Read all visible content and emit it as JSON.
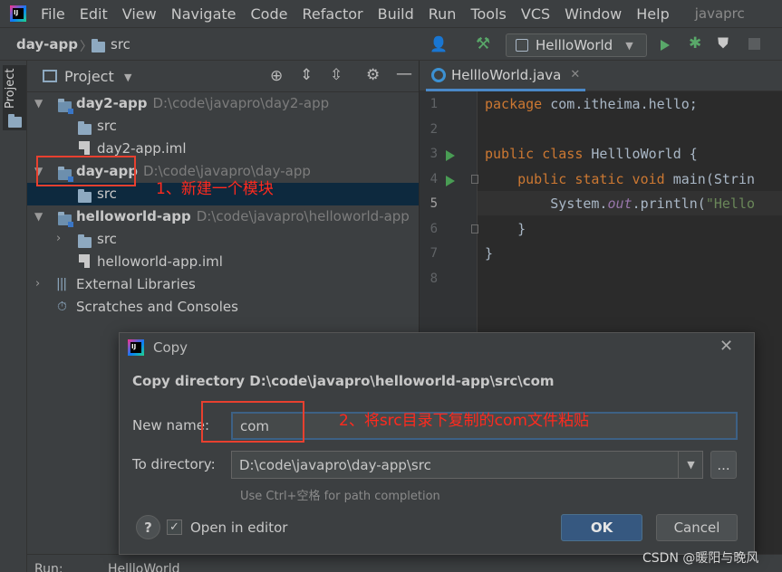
{
  "menubar": {
    "items": [
      "File",
      "Edit",
      "View",
      "Navigate",
      "Code",
      "Refactor",
      "Build",
      "Run",
      "Tools",
      "VCS",
      "Window",
      "Help"
    ],
    "project": "javaprc"
  },
  "navbar": {
    "crumb_root": "day-app",
    "crumb_child": "src",
    "run_config": "HellloWorld"
  },
  "sidebar": {
    "stripe_label": "Project"
  },
  "project_panel": {
    "title": "Project",
    "tree": [
      {
        "name": "day2-app",
        "path": "D:\\code\\javapro\\day2-app"
      },
      {
        "name": "src"
      },
      {
        "name": "day2-app.iml"
      },
      {
        "name": "day-app",
        "path": "D:\\code\\javapro\\day-app"
      },
      {
        "name": "src"
      },
      {
        "name": "helloworld-app",
        "path": "D:\\code\\javapro\\helloworld-app"
      },
      {
        "name": "src"
      },
      {
        "name": "helloworld-app.iml"
      },
      {
        "name": "External Libraries"
      },
      {
        "name": "Scratches and Consoles"
      }
    ]
  },
  "editor": {
    "tab": "HellloWorld.java",
    "line_numbers": [
      "1",
      "2",
      "3",
      "4",
      "5",
      "6",
      "7",
      "8"
    ]
  },
  "annotations": {
    "step1": "1、新建一个模块",
    "step2": "2、将src目录下复制的com文件粘贴"
  },
  "dialog": {
    "title": "Copy",
    "heading": "Copy directory D:\\code\\javapro\\helloworld-app\\src\\com",
    "new_name_label": "New name:",
    "new_name_value": "com",
    "to_directory_label": "To directory:",
    "to_directory_value": "D:\\code\\javapro\\day-app\\src",
    "browse_label": "...",
    "hint": "Use Ctrl+空格 for path completion",
    "help_label": "?",
    "open_in_editor_label": "Open in editor",
    "ok_label": "OK",
    "cancel_label": "Cancel"
  },
  "bottom": {
    "run_label": "Run:",
    "run_config": "HellloWorld"
  },
  "watermark": "CSDN @暖阳与晚风",
  "colors": {
    "accent": "#365880",
    "annotation_red": "#ff2a1e",
    "selection": "#0d293e"
  }
}
